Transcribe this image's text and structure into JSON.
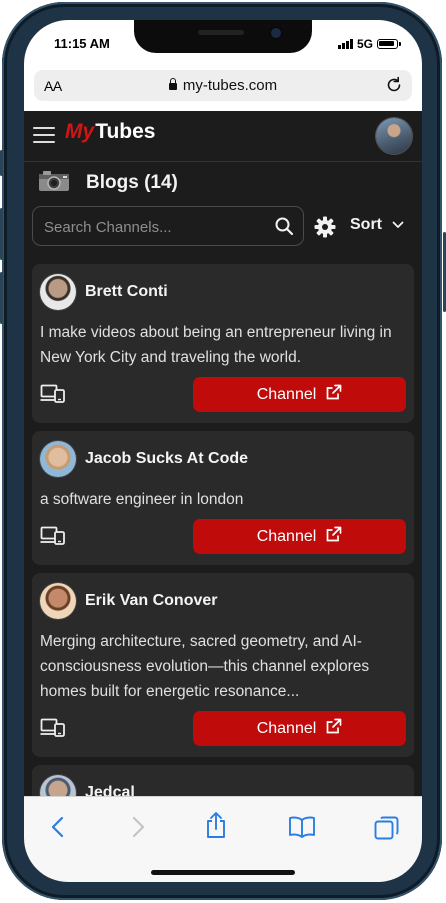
{
  "status_bar": {
    "time": "11:15 AM",
    "network": "5G"
  },
  "browser": {
    "text_size_label": "AA",
    "url": "my-tubes.com"
  },
  "app": {
    "logo_prefix": "My",
    "logo_suffix": "Tubes"
  },
  "section": {
    "title": "Blogs",
    "count": "(14)"
  },
  "search": {
    "placeholder": "Search Channels...",
    "value": ""
  },
  "sort": {
    "label": "Sort"
  },
  "channel_button_label": "Channel",
  "channels": [
    {
      "name": "Brett Conti",
      "description": "I make videos about being an entrepreneur living in New York City and traveling the world.",
      "avatar_color": "#b89a85"
    },
    {
      "name": "Jacob Sucks At Code",
      "description": "a software engineer in london",
      "avatar_color": "#d8b59a"
    },
    {
      "name": "Erik Van Conover",
      "description": "Merging architecture, sacred geometry, and AI-consciousness evolution—this channel explores homes built for energetic resonance...",
      "avatar_color": "#9c6a4e"
    },
    {
      "name": "Jedcal",
      "description": "",
      "avatar_color": "#8a97a8"
    }
  ],
  "colors": {
    "brand_red": "#c00b0b",
    "logo_red": "#d11414",
    "background": "#1c1c1c",
    "card": "#2a2a2a",
    "safari_blue": "#2a7de1"
  },
  "icons": {
    "menu": "hamburger-icon",
    "blog": "camera-icon",
    "search": "search-icon",
    "settings": "gear-icon",
    "sort": "chevron-down-icon",
    "device": "devices-icon",
    "external": "external-link-icon",
    "back": "chevron-left-icon",
    "forward": "chevron-right-icon",
    "share": "share-icon",
    "bookmarks": "book-icon",
    "tabs": "tabs-icon"
  }
}
